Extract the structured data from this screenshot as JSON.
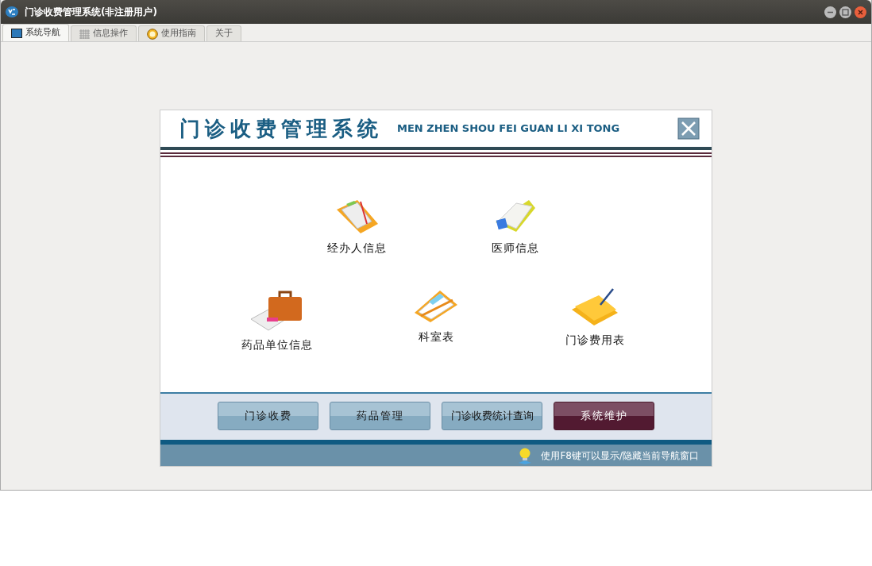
{
  "window": {
    "title": "门诊收费管理系统(非注册用户)"
  },
  "tabs": [
    {
      "label": "系统导航",
      "selected": true
    },
    {
      "label": "信息操作",
      "selected": false
    },
    {
      "label": "使用指南",
      "selected": false
    },
    {
      "label": "关于",
      "selected": false
    }
  ],
  "panel": {
    "title": "门诊收费管理系统",
    "subtitle": "MEN ZHEN SHOU FEI GUAN LI XI TONG",
    "rows": [
      [
        {
          "label": "经办人信息"
        },
        {
          "label": "医师信息"
        }
      ],
      [
        {
          "label": "药品单位信息"
        },
        {
          "label": "科室表"
        },
        {
          "label": "门诊费用表"
        }
      ]
    ],
    "buttons": [
      {
        "label": "门诊收费",
        "selected": false
      },
      {
        "label": "药品管理",
        "selected": false
      },
      {
        "label": "门诊收费统计查询",
        "selected": false
      },
      {
        "label": "系统维护",
        "selected": true
      }
    ],
    "hint": "使用F8键可以显示/隐藏当前导航窗口"
  }
}
